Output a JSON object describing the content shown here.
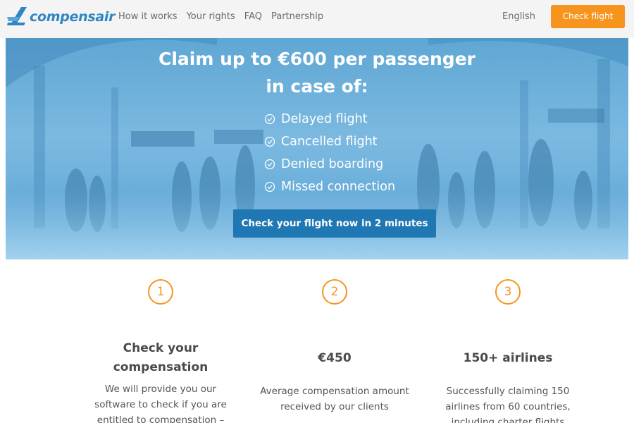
{
  "header": {
    "logo_text": "compensair",
    "nav": [
      "How it works",
      "Your rights",
      "FAQ",
      "Partnership"
    ],
    "language": "English",
    "cta_label": "Check flight"
  },
  "hero": {
    "title_line1": "Claim up to €600 per passenger",
    "title_line2": "in case of:",
    "benefits": [
      "Delayed flight",
      "Cancelled flight",
      "Denied boarding",
      "Missed connection"
    ],
    "cta_label": "Check your flight now in 2 minutes"
  },
  "features": [
    {
      "number": "1",
      "title": "Check your compensation",
      "description": "We will provide you our software to check if you are entitled to compensation – totally free"
    },
    {
      "number": "2",
      "title": "€450",
      "description": "Average compensation amount received by our clients"
    },
    {
      "number": "3",
      "title": "150+ airlines",
      "description": "Successfully claiming 150 airlines from 60 countries, including charter flights"
    }
  ],
  "colors": {
    "brand_blue": "#2f86c2",
    "accent_orange": "#f7941e",
    "cta_blue": "#1f77b4"
  }
}
